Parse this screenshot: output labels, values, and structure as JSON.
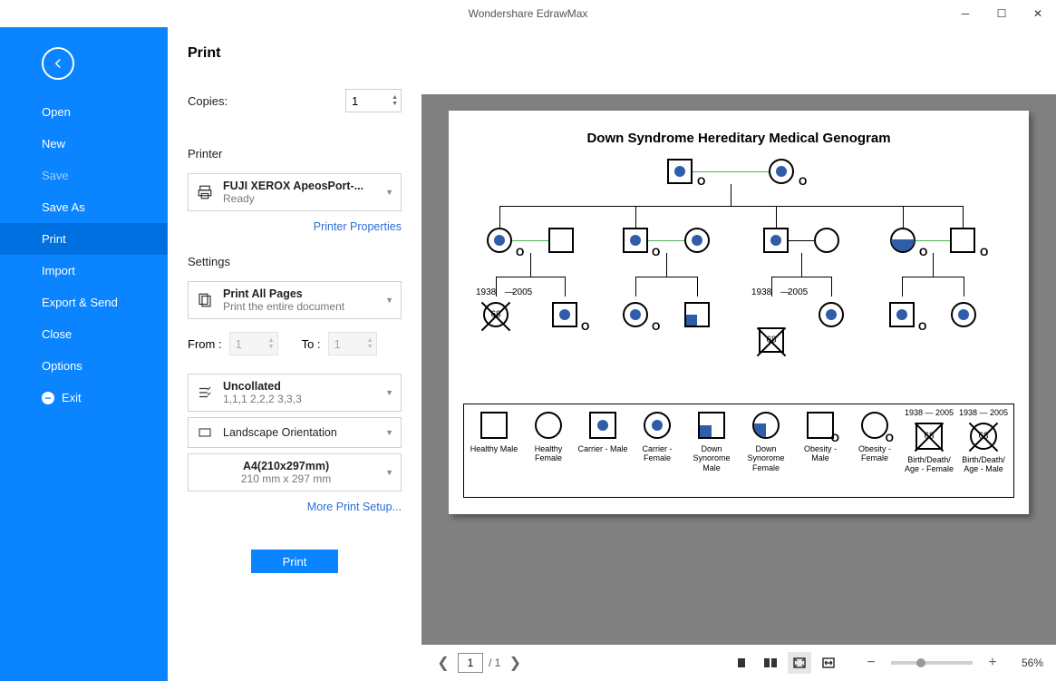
{
  "app_title": "Wondershare EdrawMax",
  "sidebar": {
    "items": [
      "Open",
      "New",
      "Save",
      "Save As",
      "Print",
      "Import",
      "Export & Send",
      "Close",
      "Options",
      "Exit"
    ]
  },
  "page_title": "Print",
  "copies": {
    "label": "Copies:",
    "value": "1"
  },
  "printer": {
    "section_label": "Printer",
    "name": "FUJI XEROX ApeosPort-...",
    "status": "Ready",
    "properties_link": "Printer Properties"
  },
  "settings": {
    "section_label": "Settings",
    "print_all": {
      "title": "Print All Pages",
      "sub": "Print the entire document"
    },
    "from_label": "From :",
    "to_label": "To :",
    "from_value": "1",
    "to_value": "1",
    "collate": {
      "title": "Uncollated",
      "sub": "1,1,1   2,2,2   3,3,3"
    },
    "orientation": "Landscape Orientation",
    "paper": {
      "title": "A4(210x297mm)",
      "sub": "210 mm x 297 mm"
    },
    "more_link": "More Print Setup..."
  },
  "print_button": "Print",
  "preview": {
    "doc_title": "Down Syndrome Hereditary Medical Genogram",
    "page_current": "1",
    "page_total": "/ 1",
    "zoom": "56%",
    "years1": "1938",
    "years2": "2005",
    "age68": "68",
    "legend": [
      "Healthy Male",
      "Healthy Female",
      "Carrier - Male",
      "Carrier - Female",
      "Down Synorome Male",
      "Down Synorome Female",
      "Obesity - Male",
      "Obesity - Female",
      "Birth/Death/ Age - Female",
      "Birth/Death/ Age - Male"
    ]
  }
}
